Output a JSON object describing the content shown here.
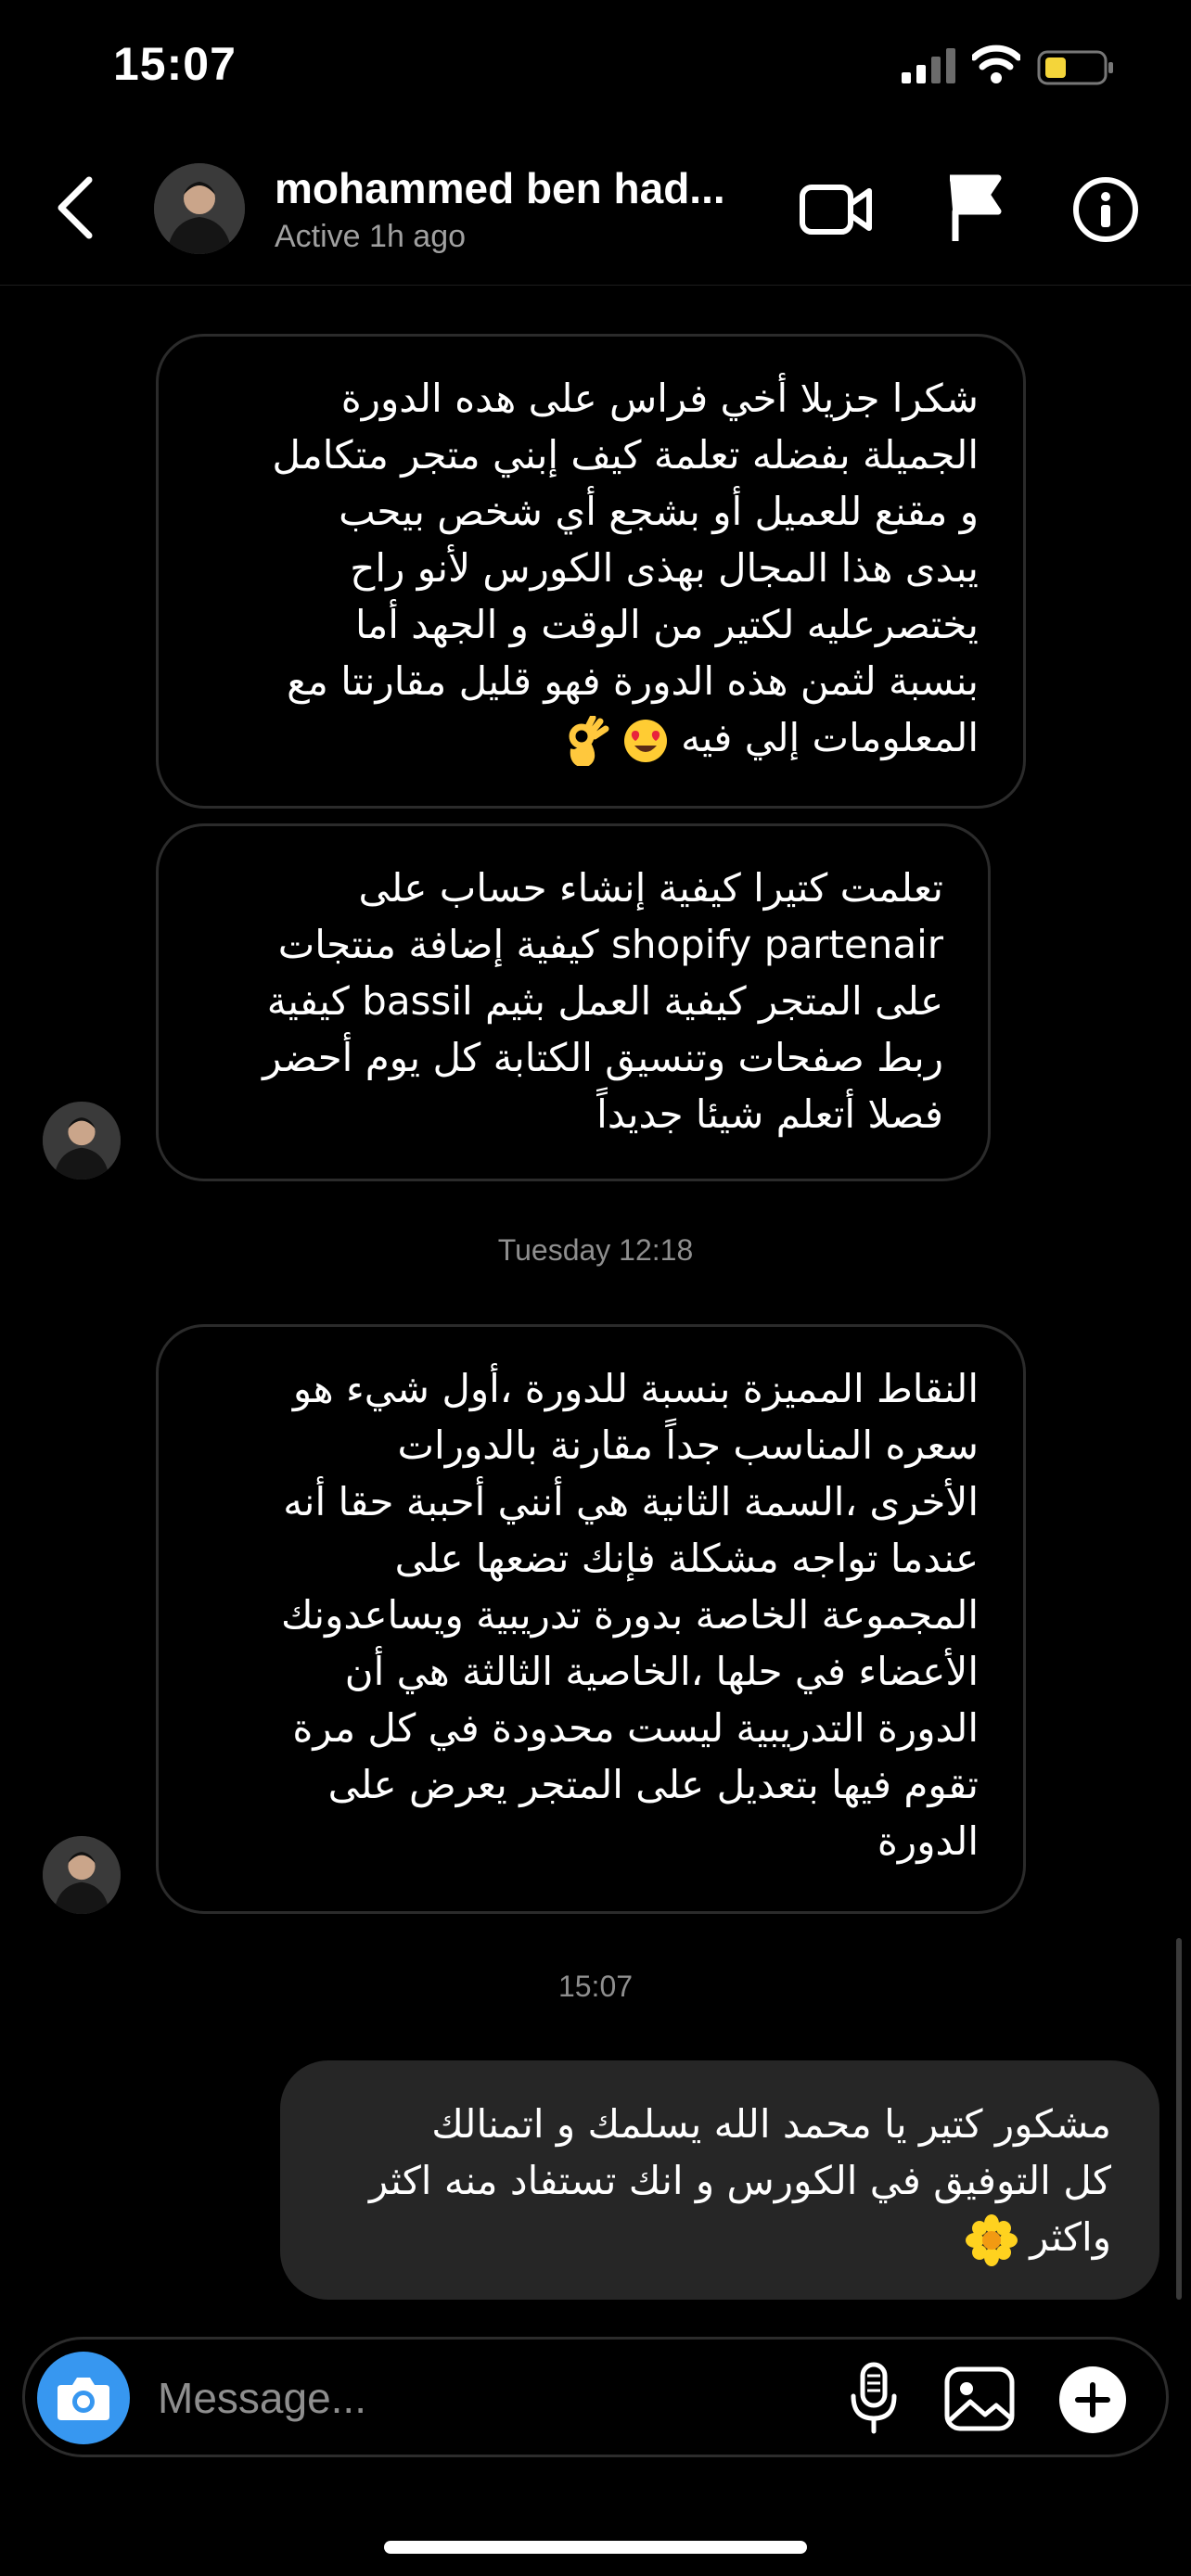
{
  "status_bar": {
    "time": "15:07"
  },
  "header": {
    "name": "mohammed ben had...",
    "status": "Active 1h ago"
  },
  "messages": [
    {
      "from": "them",
      "lines": [
        "شكرا جزيلا أخي فراس على هده الدورة",
        "الجميلة بفضله تعلمة كيف إبني متجر متكامل",
        "و مقنع للعميل أو بشجع أي شخص بيحب",
        "يبدى هذا المجال بهذى الكورس لأنو راح",
        "يختصرعليه لكتير من الوقت و الجهد أما",
        "بنسبة لثمن هذه الدورة فهو قليل مقارنتا مع",
        "المعلومات  إلي فيه"
      ]
    },
    {
      "from": "them",
      "lines": [
        "تعلمت كتيرا كيفية إنشاء حساب على",
        "shopify partenair كيفية إضافة منتجات",
        "على المتجر كيفية العمل بثيم bassil كيفية",
        "ربط  صفحات وتنسيق الكتابة كل يوم أحضر",
        "فصلا أتعلم شيئا جديداً"
      ]
    },
    {
      "from": "them",
      "lines": [
        "النقاط المميزة بنسبة للدورة ،أول شيء هو",
        "سعره المناسب جداً مقارنة بالدورات",
        "الأخرى ،السمة الثانية هي أنني أحببة حقا أنه",
        "عندما تواجه مشكلة فإنك تضعها على",
        "المجموعة الخاصة بدورة تدريبية ويساعدونك",
        "الأعضاء في حلها ،الخاصية الثالثة هي أن",
        "الدورة التدريبية ليست محدودة في كل مرة",
        "تقوم فيها بتعديل على المتجر يعرض على",
        "الدورة"
      ]
    },
    {
      "from": "me",
      "lines": [
        "مشكور كتير يا محمد الله يسلمك و اتمنالك",
        "كل التوفيق في الكورس و انك تستفاد منه اكثر",
        "واكثر"
      ]
    }
  ],
  "timestamps": {
    "t1": "Tuesday 12:18",
    "t2": "15:07"
  },
  "composer": {
    "placeholder": "Message..."
  },
  "colors": {
    "accent": "#3797f0",
    "outgoing_bubble": "#262626",
    "bubble_border": "#2b2b2b"
  }
}
